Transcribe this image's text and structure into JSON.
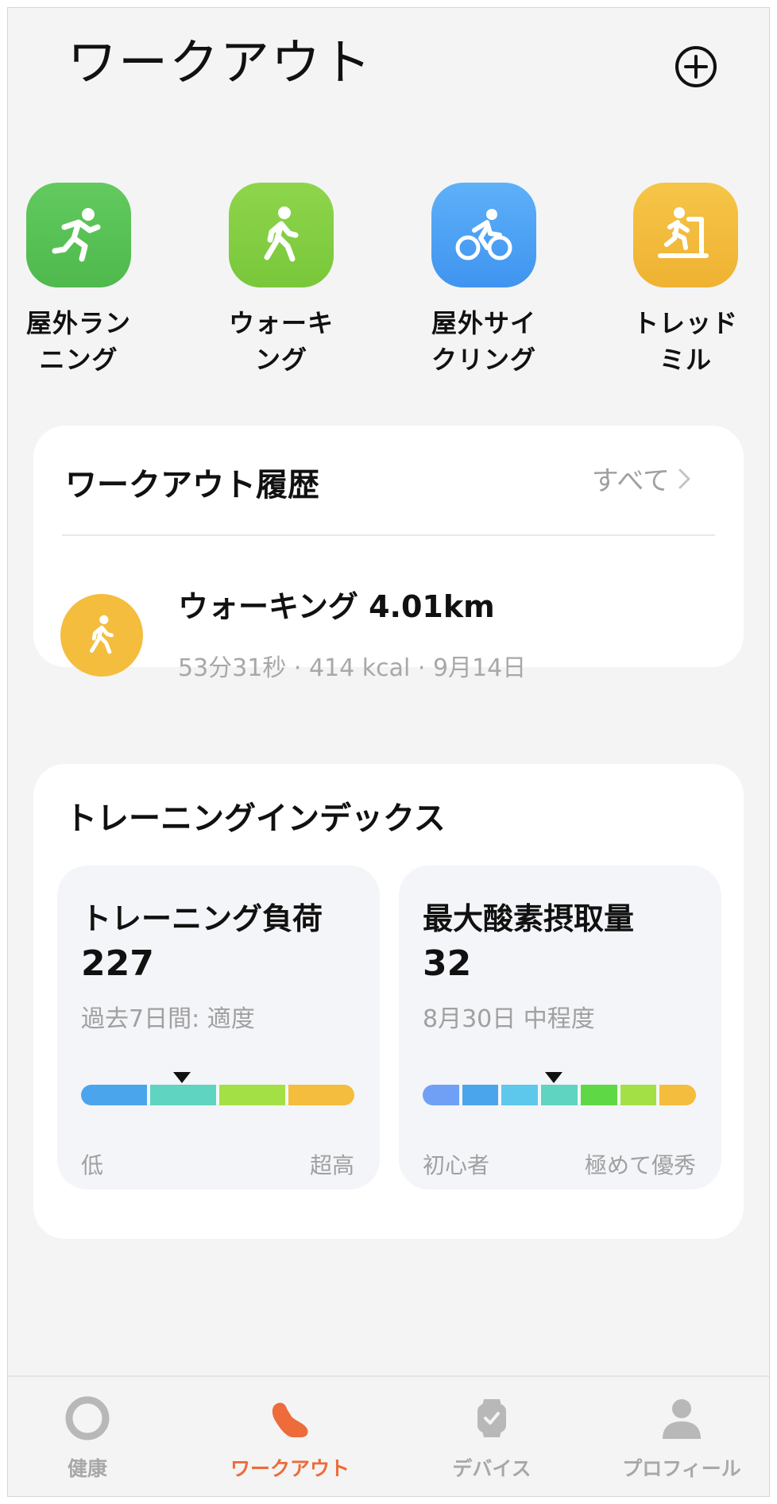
{
  "header": {
    "title": "ワークアウト",
    "add_icon": "plus-circle-icon"
  },
  "quick_start": [
    {
      "label": "屋外ラン\nニング",
      "icon": "running-icon",
      "color": "#5dc35a"
    },
    {
      "label": "ウォーキ\nング",
      "icon": "walking-icon",
      "color": "#86d045"
    },
    {
      "label": "屋外サイ\nクリング",
      "icon": "cycling-icon",
      "color": "#4aa0f5"
    },
    {
      "label": "トレッド\nミル",
      "icon": "treadmill-icon",
      "color": "#f4bd3d"
    }
  ],
  "history": {
    "title": "ワークアウト履歴",
    "see_all": "すべて",
    "item": {
      "name": "ウォーキング 4.01km",
      "meta": "53分31秒 · 414 kcal · 9月14日",
      "icon": "walking-icon",
      "color": "#f4bd3d"
    }
  },
  "training_index": {
    "title": "トレーニングインデックス",
    "load": {
      "title": "トレーニング負荷",
      "value": "227",
      "desc": "過去7日間:  適度",
      "low_label": "低",
      "high_label": "超高",
      "segment_colors": [
        "#4aa5ec",
        "#5fd4c0",
        "#a3e045",
        "#f4bd3d"
      ],
      "level": 0.37
    },
    "vo2": {
      "title": "最大酸素摂取量",
      "value": "32",
      "desc": "8月30日  中程度",
      "low_label": "初心者",
      "high_label": "極めて優秀",
      "segment_colors": [
        "#6fa0f5",
        "#4aa5ec",
        "#5dc8ec",
        "#5fd4c0",
        "#5fd845",
        "#a3e045",
        "#f4bd3d"
      ],
      "level": 0.48
    }
  },
  "tabbar": [
    {
      "label": "健康",
      "icon": "ring-icon",
      "active": false
    },
    {
      "label": "ワークアウト",
      "icon": "shoe-icon",
      "active": true
    },
    {
      "label": "デバイス",
      "icon": "watch-icon",
      "active": false
    },
    {
      "label": "プロフィール",
      "icon": "person-icon",
      "active": false
    }
  ],
  "colors": {
    "accent": "#ee6b3a",
    "inactive": "#a8a8a8"
  }
}
